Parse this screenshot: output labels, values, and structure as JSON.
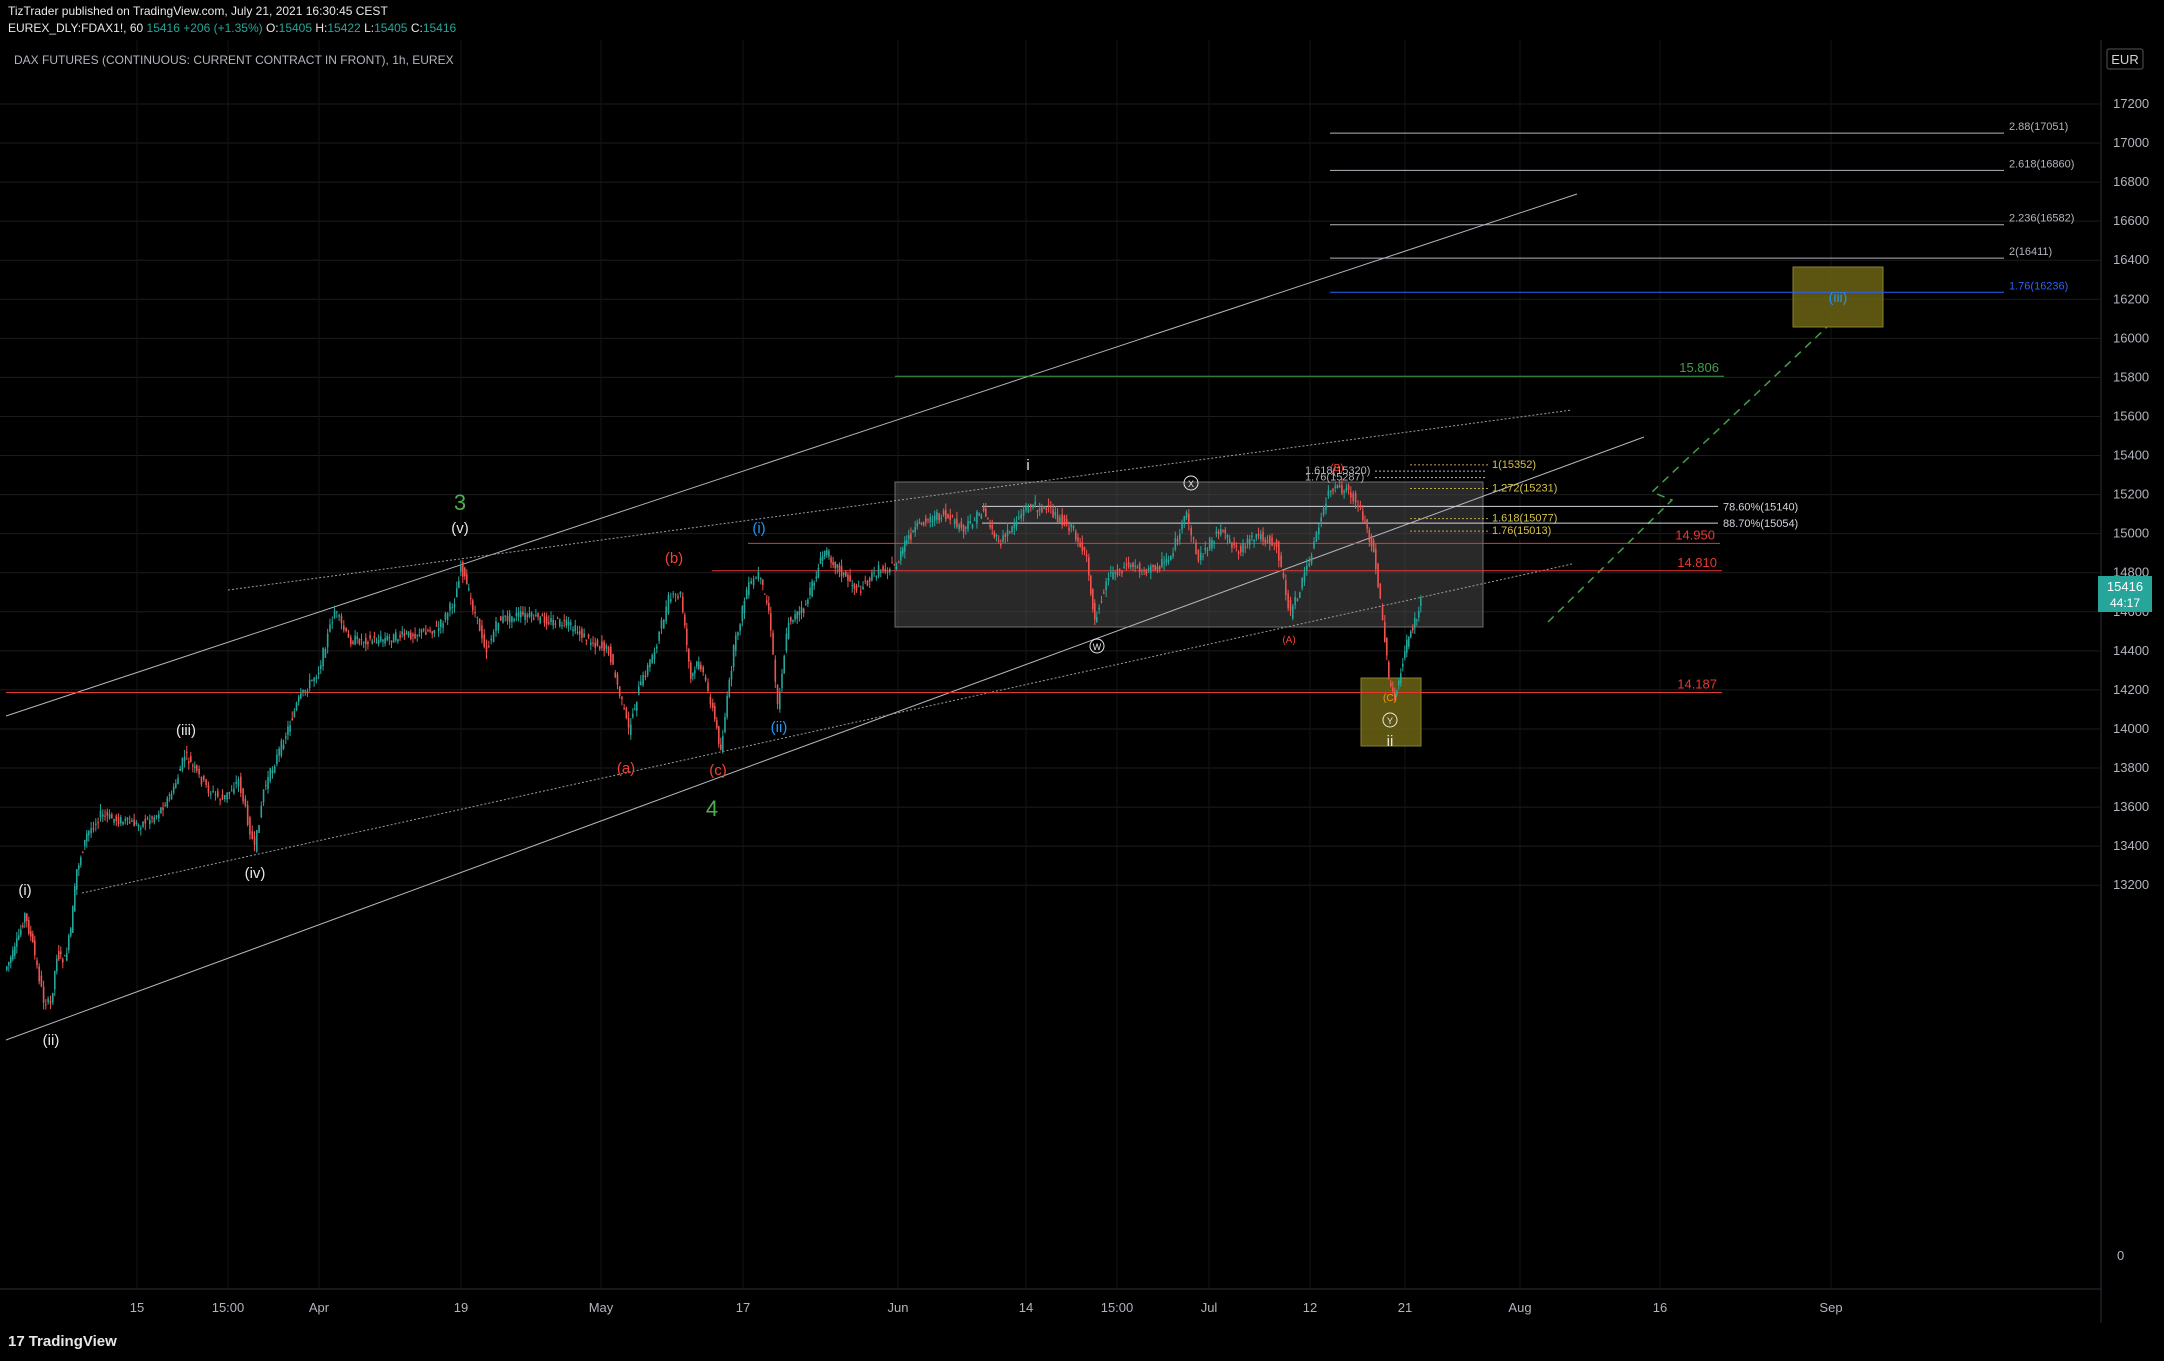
{
  "header": {
    "publisher_line": "TizTrader published on TradingView.com, July 21, 2021 16:30:45 CEST",
    "symbol": "EUREX_DLY:FDAX1!, 60",
    "last": "15416",
    "change": "+206 (+1.35%)",
    "open_label": "O:",
    "open": "15405",
    "high_label": "H:",
    "high": "15422",
    "low_label": "L:",
    "low": "15405",
    "close_label": "C:",
    "close": "15416"
  },
  "chart_title": "DAX FUTURES (CONTINUOUS: CURRENT CONTRACT IN FRONT), 1h, EUREX",
  "currency": "EUR",
  "price_axis": {
    "labels": [
      "17200",
      "17000",
      "16800",
      "16600",
      "16400",
      "16200",
      "16000",
      "15800",
      "15600",
      "15400",
      "15200",
      "15000",
      "14800",
      "14600",
      "14400",
      "14200",
      "14000",
      "13800",
      "13600",
      "13400",
      "13200"
    ],
    "last_price": "15416",
    "countdown": "44:17",
    "zero_label": "0"
  },
  "time_axis": {
    "labels": [
      "15",
      "15:00",
      "Apr",
      "19",
      "May",
      "17",
      "Jun",
      "14",
      "15:00",
      "Jul",
      "12",
      "21",
      "Aug",
      "16",
      "Sep"
    ]
  },
  "levels": {
    "fib_ext": [
      {
        "label": "2.88(17051)",
        "price": 17051,
        "color": "#b2b5be"
      },
      {
        "label": "2.618(16860)",
        "price": 16860,
        "color": "#b2b5be"
      },
      {
        "label": "2.236(16582)",
        "price": 16582,
        "color": "#b2b5be"
      },
      {
        "label": "2(16411)",
        "price": 16411,
        "color": "#b2b5be"
      },
      {
        "label": "1.76(16236)",
        "price": 16236,
        "color": "#2962ff"
      }
    ],
    "horizontal": [
      {
        "label": "15.806",
        "price": 15806,
        "color": "#43a047"
      },
      {
        "label": "14.950",
        "price": 14950,
        "color": "#e53935"
      },
      {
        "label": "14.810",
        "price": 14810,
        "color": "#e53935"
      },
      {
        "label": "14.187",
        "price": 14187,
        "color": "#e53935"
      }
    ],
    "retrace": [
      {
        "label": "78.60%(15140)",
        "price": 15140
      },
      {
        "label": "88.70%(15054)",
        "price": 15054
      }
    ],
    "yellow_fibs": [
      {
        "label": "1(15352)",
        "price": 15352
      },
      {
        "label": "1.272(15231)",
        "price": 15231
      },
      {
        "label": "1.618(15077)",
        "price": 15077
      },
      {
        "label": "1.76(15013)",
        "price": 15013
      }
    ],
    "white_fibs": [
      {
        "label": "1.618(15320)",
        "price": 15320
      },
      {
        "label": "1.76(15287)",
        "price": 15287
      }
    ]
  },
  "waves": {
    "w3": "3",
    "w4": "4",
    "i": "(i)",
    "ii": "(ii)",
    "iii": "(iii)",
    "iv": "(iv)",
    "v": "(v)",
    "a": "(a)",
    "b": "(b)",
    "c": "(c)",
    "blue_i": "(i)",
    "blue_ii": "(ii)",
    "blue_iii": "(iii)",
    "small_i": "i",
    "small_ii": "ii",
    "W": "W",
    "X": "X",
    "Y": "Y",
    "A": "(A)",
    "B": "(B)",
    "C": "(C)"
  },
  "colors": {
    "background": "#000000",
    "up": "#26a69a",
    "down": "#ef5350",
    "wave_green": "#4caf50",
    "wave_red": "#f44336",
    "wave_blue": "#2196f3",
    "target_box": "#6b6414",
    "range_box": "#4a4a4a"
  },
  "branding": {
    "logo_text": "TradingView",
    "logo_mark": "17"
  }
}
